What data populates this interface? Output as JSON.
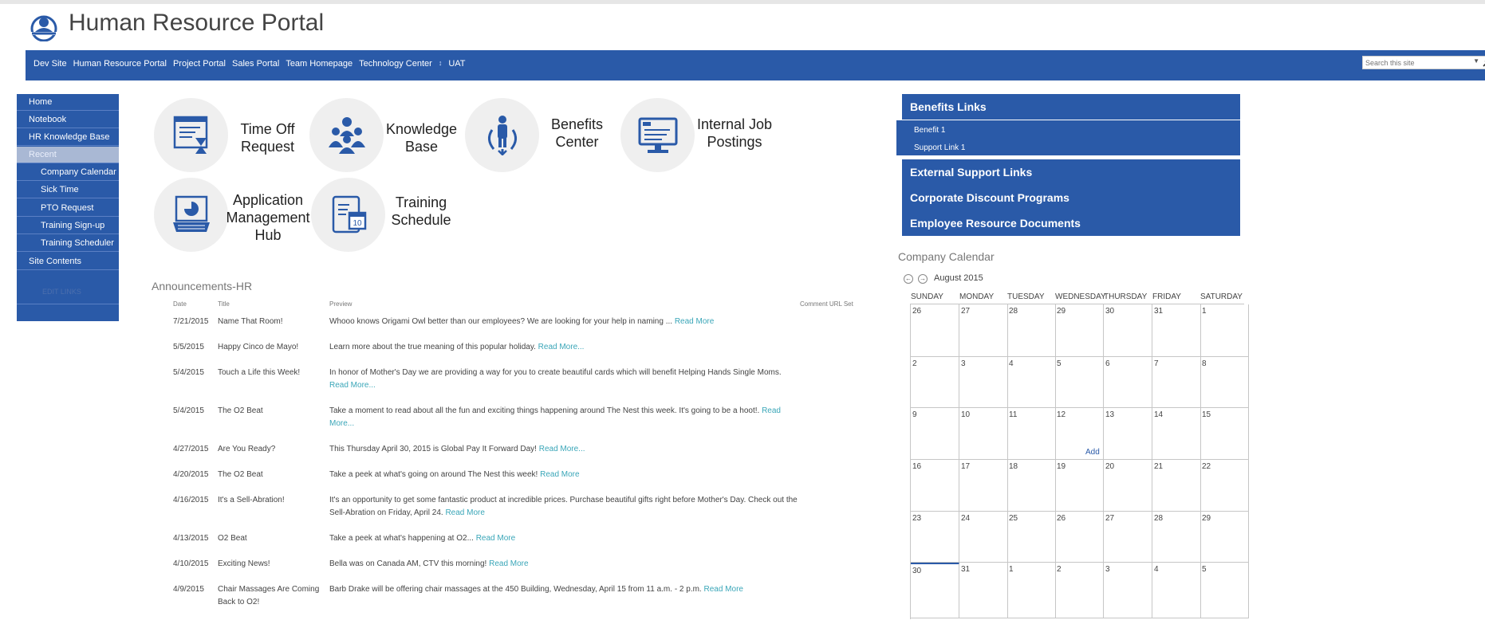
{
  "header": {
    "title": "Human Resource Portal"
  },
  "topnav": {
    "items": [
      "Dev Site",
      "Human Resource Portal",
      "Project Portal",
      "Sales Portal",
      "Team Homepage",
      "Technology Center",
      "UAT"
    ],
    "search_placeholder": "Search this site"
  },
  "leftnav": {
    "items": [
      "Home",
      "Notebook",
      "HR Knowledge Base",
      "Recent",
      "Company Calendar",
      "Sick Time",
      "PTO Request",
      "Training Sign-up",
      "Training Scheduler",
      "Site Contents"
    ],
    "edit_links": "EDIT LINKS"
  },
  "tiles": [
    {
      "label": "Time Off Request",
      "icon": "time-off-icon"
    },
    {
      "label": "Knowledge Base",
      "icon": "team-icon"
    },
    {
      "label": "Benefits Center",
      "icon": "benefits-icon"
    },
    {
      "label": "Internal Job Postings",
      "icon": "jobs-monitor-icon"
    },
    {
      "label": "Application Management Hub",
      "icon": "laptop-chart-icon"
    },
    {
      "label": "Training Schedule",
      "icon": "calendar-tablet-icon"
    }
  ],
  "announcements": {
    "title": "Announcements-HR",
    "headers": {
      "date": "Date",
      "title": "Title",
      "preview": "Preview",
      "comment": "Comment URL Set"
    },
    "rows": [
      {
        "date": "7/21/2015",
        "title": "Name That Room!",
        "preview": "Whooo knows Origami Owl better than our employees? We are looking for your help in naming ...",
        "more": "Read More"
      },
      {
        "date": "5/5/2015",
        "title": "Happy Cinco de Mayo!",
        "preview": "Learn more about the true meaning of this popular holiday.",
        "more": "Read More..."
      },
      {
        "date": "5/4/2015",
        "title": "Touch a Life this Week!",
        "preview": "In honor of Mother's Day we are providing a way for you to create beautiful cards which will benefit Helping Hands Single Moms.",
        "more": "Read More..."
      },
      {
        "date": "5/4/2015",
        "title": "The O2 Beat",
        "preview": "Take a moment to read about all the fun and exciting things happening around The Nest this week. It's going to be a hoot!.",
        "more": "Read More..."
      },
      {
        "date": "4/27/2015",
        "title": "Are You Ready?",
        "preview": "This Thursday April 30, 2015 is Global Pay It Forward Day!",
        "more": "Read More..."
      },
      {
        "date": "4/20/2015",
        "title": "The O2 Beat",
        "preview": "Take a peek at what's going on around The Nest this week!",
        "more": "Read More"
      },
      {
        "date": "4/16/2015",
        "title": "It's a Sell-Abration!",
        "preview": "It's an opportunity to get some fantastic product at incredible prices. Purchase beautiful gifts right before Mother's Day. Check out the Sell-Abration on Friday, April 24.",
        "more": "Read More"
      },
      {
        "date": "4/13/2015",
        "title": "O2 Beat",
        "preview": "Take a peek at what's happening at O2...",
        "more": "Read More"
      },
      {
        "date": "4/10/2015",
        "title": "Exciting News!",
        "preview": "Bella was on Canada AM, CTV this morning!",
        "more": "Read More"
      },
      {
        "date": "4/9/2015",
        "title": "Chair Massages Are Coming Back to O2!",
        "preview": "Barb Drake will be offering chair massages at the 450 Building, Wednesday, April 15 from 11 a.m. - 2 p.m.",
        "more": "Read More"
      }
    ]
  },
  "links": {
    "benefits": {
      "title": "Benefits Links",
      "items": [
        "Benefit 1",
        "Support Link 1"
      ]
    },
    "external": "External Support Links",
    "discount": "Corporate Discount Programs",
    "documents": "Employee Resource Documents"
  },
  "calendar": {
    "title": "Company Calendar",
    "month": "August 2015",
    "days": [
      "SUNDAY",
      "MONDAY",
      "TUESDAY",
      "WEDNESDAY",
      "THURSDAY",
      "FRIDAY",
      "SATURDAY"
    ],
    "weeks": [
      [
        "26",
        "27",
        "28",
        "29",
        "30",
        "31",
        "1"
      ],
      [
        "2",
        "3",
        "4",
        "5",
        "6",
        "7",
        "8"
      ],
      [
        "9",
        "10",
        "11",
        "12",
        "13",
        "14",
        "15"
      ],
      [
        "16",
        "17",
        "18",
        "19",
        "20",
        "21",
        "22"
      ],
      [
        "23",
        "24",
        "25",
        "26",
        "27",
        "28",
        "29"
      ],
      [
        "30",
        "31",
        "1",
        "2",
        "3",
        "4",
        "5"
      ]
    ],
    "add_label": "Add"
  },
  "colors": {
    "brand": "#2a5aa8",
    "link": "#3aa6b8",
    "tile_bg": "#efefef"
  }
}
